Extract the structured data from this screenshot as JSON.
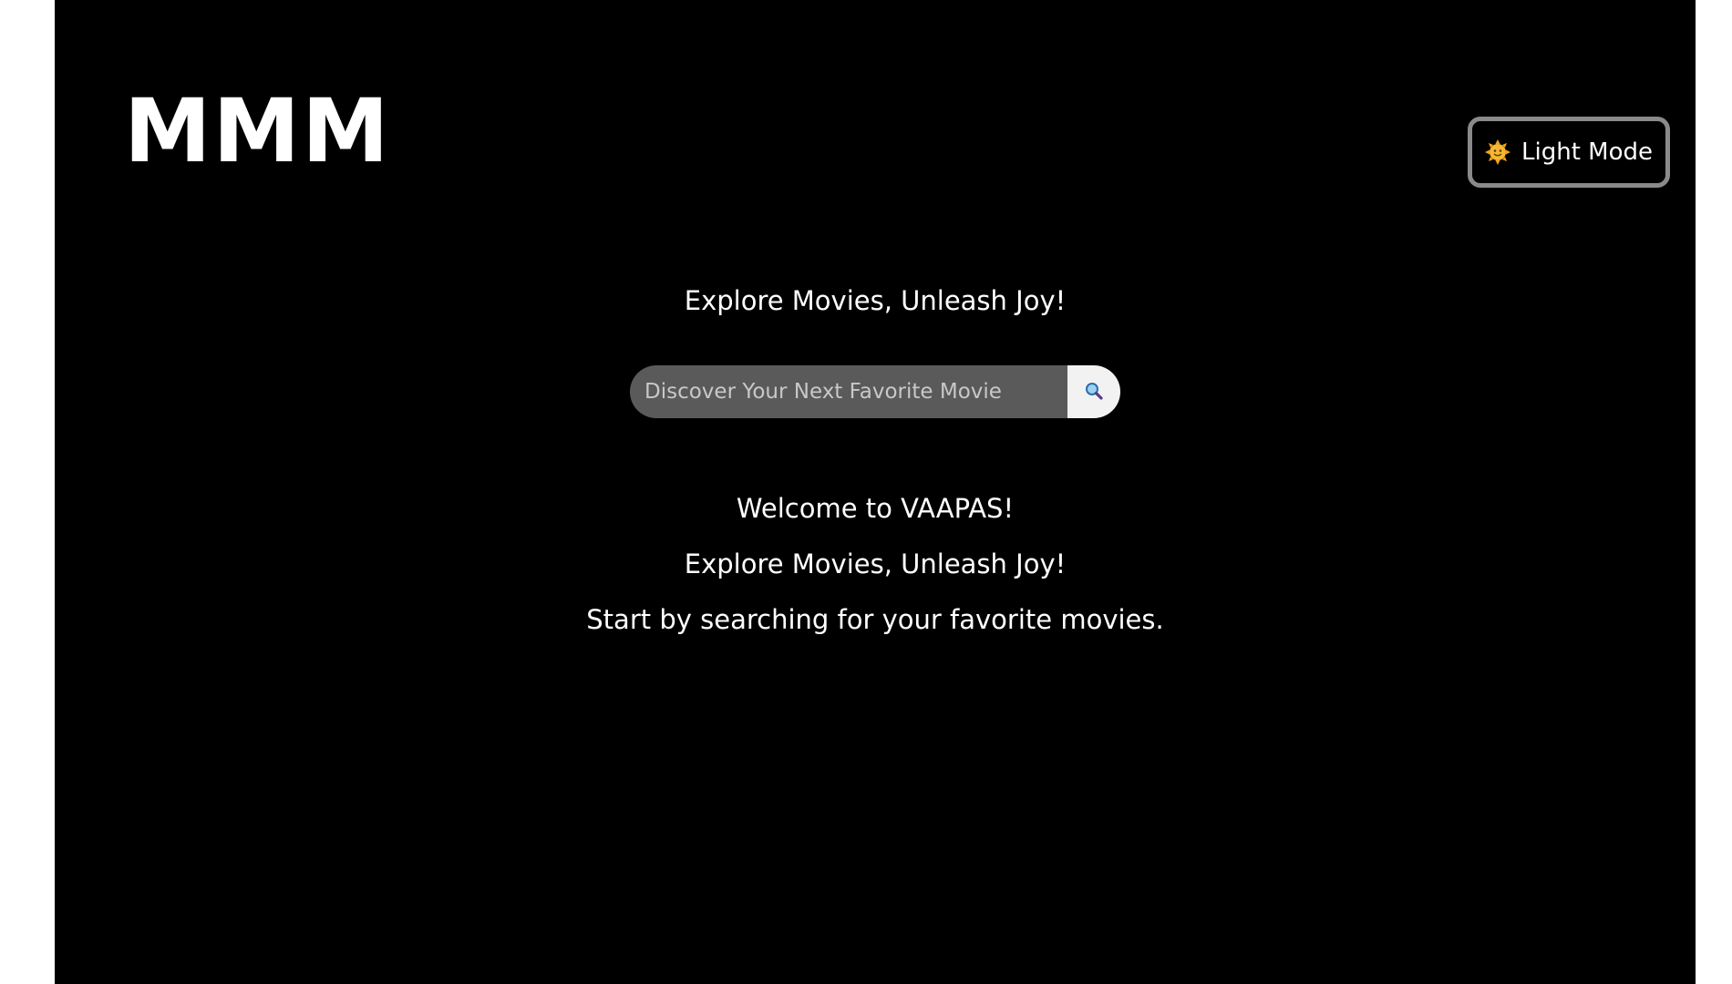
{
  "header": {
    "logo": "MMM",
    "theme_toggle": {
      "label": "Light Mode",
      "icon": "sun-face-icon"
    }
  },
  "hero": {
    "tagline": "Explore Movies, Unleash Joy!"
  },
  "search": {
    "placeholder": "Discover Your Next Favorite Movie",
    "value": "",
    "button_icon": "magnifier-icon"
  },
  "welcome": {
    "title": "Welcome to VAAPAS!",
    "subtitle": "Explore Movies, Unleash Joy!",
    "hint": "Start by searching for your favorite movies."
  },
  "colors": {
    "background": "#000000",
    "text": "#ffffff",
    "search_field": "#5a5a5a",
    "search_button": "#f2f2f2",
    "toggle_border": "#8a8a8a"
  }
}
